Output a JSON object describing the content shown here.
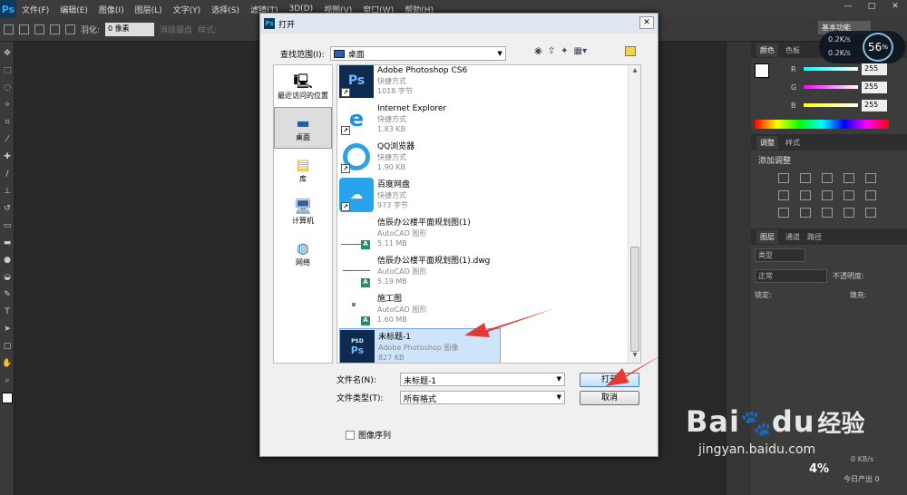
{
  "app": {
    "logo": "Ps"
  },
  "menu": [
    "文件(F)",
    "编辑(E)",
    "图像(I)",
    "图层(L)",
    "文字(Y)",
    "选择(S)",
    "滤镜(T)",
    "3D(D)",
    "视图(V)",
    "窗口(W)",
    "帮助(H)"
  ],
  "window_controls": [
    "—",
    "□",
    "✕"
  ],
  "options_bar": {
    "feather_label": "羽化:",
    "feather_value": "0 像素",
    "antialias": "消除锯齿",
    "style": "样式:"
  },
  "workspace": "基本功能",
  "net_widget": {
    "percent": "56",
    "pct_sign": "%",
    "up": "0.2K/s",
    "down": "0.2K/s"
  },
  "panels": {
    "color_tabs": [
      "颜色",
      "色板"
    ],
    "rgb": [
      {
        "label": "R",
        "value": "255"
      },
      {
        "label": "G",
        "value": "255"
      },
      {
        "label": "B",
        "value": "255"
      }
    ],
    "adjust_tabs": [
      "调整",
      "样式"
    ],
    "adjust_title": "添加调整",
    "layers_tabs": [
      "图层",
      "通道",
      "路径"
    ],
    "layer_kind": "类型",
    "blend_mode": "正常",
    "opacity_label": "不透明度:",
    "lock_label": "锁定:",
    "fill_label": "填充:"
  },
  "dialog": {
    "title": "打开",
    "close": "✕",
    "lookin_label": "查找范围(I):",
    "lookin_value": "桌面",
    "places": [
      {
        "label": "最近访问的位置",
        "icon": "recent-icon"
      },
      {
        "label": "桌面",
        "icon": "desktop-icon"
      },
      {
        "label": "库",
        "icon": "library-icon"
      },
      {
        "label": "计算机",
        "icon": "computer-icon"
      },
      {
        "label": "网络",
        "icon": "network-icon"
      }
    ],
    "files": [
      {
        "name": "Adobe Photoshop CS6",
        "type": "快捷方式",
        "size": "1018 字节",
        "icon": "ps"
      },
      {
        "name": "Internet Explorer",
        "type": "快捷方式",
        "size": "1.83 KB",
        "icon": "ie"
      },
      {
        "name": "QQ浏览器",
        "type": "快捷方式",
        "size": "1.90 KB",
        "icon": "qq"
      },
      {
        "name": "百度网盘",
        "type": "快捷方式",
        "size": "973 字节",
        "icon": "baidu"
      },
      {
        "name": "信辰办公楼平面规划图(1)",
        "type": "AutoCAD 图形",
        "size": "5.11 MB",
        "icon": "dwg"
      },
      {
        "name": "信辰办公楼平面规划图(1).dwg",
        "type": "AutoCAD 图形",
        "size": "5.19 MB",
        "icon": "dwg"
      },
      {
        "name": "施工图",
        "type": "AutoCAD 图形",
        "size": "1.60 MB",
        "icon": "dwg"
      },
      {
        "name": "未标题-1",
        "type": "Adobe Photoshop 图像",
        "size": "827 KB",
        "icon": "psd"
      }
    ],
    "filename_label": "文件名(N):",
    "filename_value": "未标题-1",
    "filetype_label": "文件类型(T):",
    "filetype_value": "所有格式",
    "open_button": "打开",
    "cancel_button": "取消",
    "image_sequence": "图像序列"
  },
  "watermark": {
    "main": "Bai",
    "paw": "du",
    "jy": "经验",
    "sub": "jingyan.baidu.com"
  },
  "status": {
    "today": "今日产出 0",
    "speed": "0 KB/s",
    "pct": "4%"
  }
}
